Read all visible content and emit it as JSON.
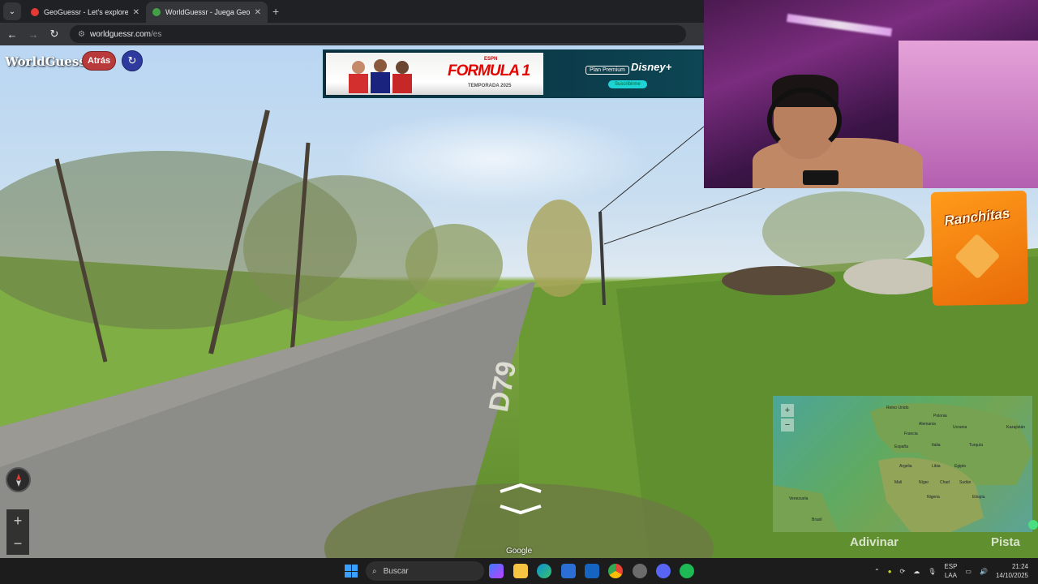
{
  "browser": {
    "tabs": [
      {
        "title": "GeoGuessr - Let's explore the w",
        "active": false,
        "favicon_color": "#e53935"
      },
      {
        "title": "WorldGuessr - Juega GeoGuess",
        "active": true,
        "favicon_color": "#43a047"
      }
    ],
    "url_domain": "worldguessr.com",
    "url_path": "/es"
  },
  "game": {
    "logo": "WorldGuessr",
    "back_label": "Atrás",
    "road_marking": "D79",
    "google_watermark": "Google",
    "guess_label": "Adivinar",
    "hint_label": "Pista",
    "zoom_in": "+",
    "zoom_out": "−"
  },
  "ad": {
    "brand": "FORMULA 1",
    "season": "TEMPORADA 2025",
    "network": "ESPN",
    "plan": "Plan Premium",
    "disney": "Disney+",
    "cta": "Suscribirme"
  },
  "minimap": {
    "labels": [
      "Reino Unido",
      "Polonia",
      "Alemania",
      "Ucrania",
      "Francia",
      "Kazajistán",
      "España",
      "Italia",
      "Turquía",
      "Argelia",
      "Libia",
      "Egipto",
      "Mali",
      "Níger",
      "Chad",
      "Sudán",
      "Nigeria",
      "Etiopía",
      "Venezuela",
      "Brasil"
    ]
  },
  "chips": {
    "brand": "Ranchitas"
  },
  "taskbar": {
    "search_placeholder": "Buscar",
    "lang_top": "ESP",
    "lang_bottom": "LAA",
    "time": "21:24",
    "date": "14/10/2025"
  }
}
